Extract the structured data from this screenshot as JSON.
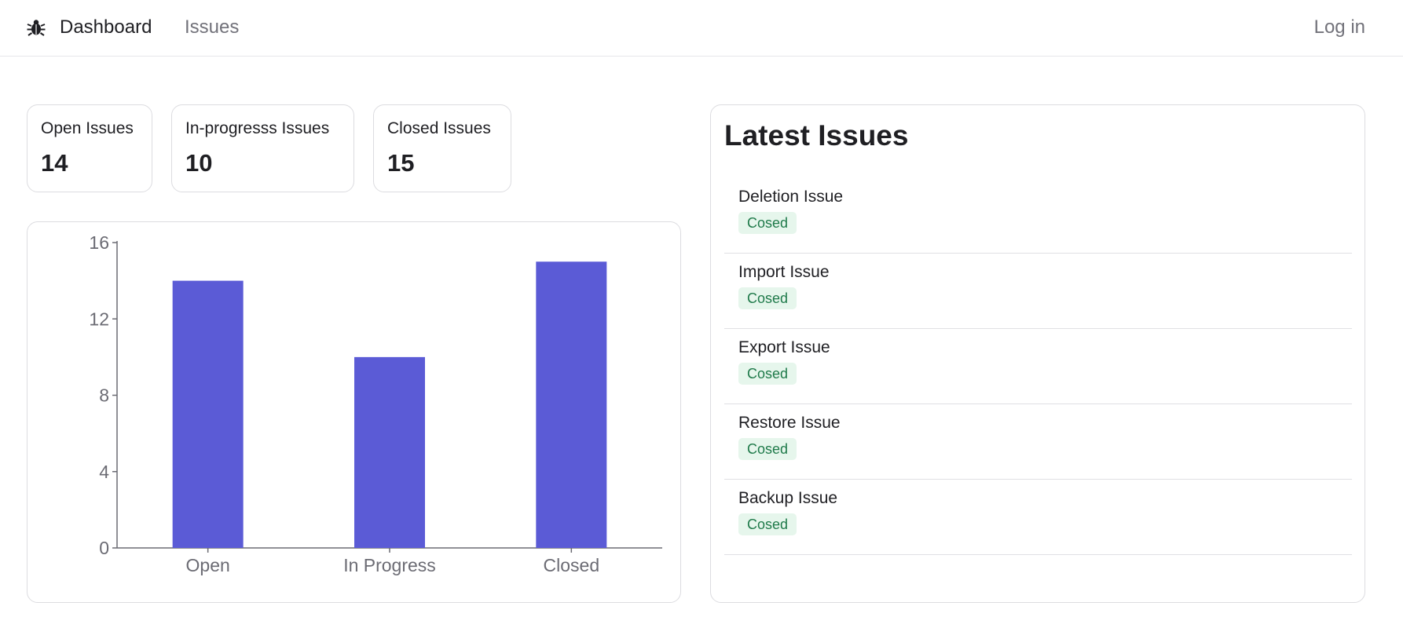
{
  "nav": {
    "logo_icon": "bug-icon",
    "dashboard_label": "Dashboard",
    "issues_label": "Issues",
    "login_label": "Log in"
  },
  "stats": [
    {
      "label": "Open Issues",
      "value": "14"
    },
    {
      "label": "In-progresss Issues",
      "value": "10"
    },
    {
      "label": "Closed Issues",
      "value": "15"
    }
  ],
  "colors": {
    "accent": "#5b5bd6",
    "badge_bg": "#e6f6ec",
    "badge_text": "#1f7a4a"
  },
  "chart_data": {
    "type": "bar",
    "categories": [
      "Open",
      "In Progress",
      "Closed"
    ],
    "values": [
      14,
      10,
      15
    ],
    "ylim": [
      0,
      16
    ],
    "yticks": [
      0,
      4,
      8,
      12,
      16
    ],
    "grid": false
  },
  "latest": {
    "title": "Latest Issues",
    "items": [
      {
        "title": "Deletion Issue",
        "status": "Cosed"
      },
      {
        "title": "Import Issue",
        "status": "Cosed"
      },
      {
        "title": "Export Issue",
        "status": "Cosed"
      },
      {
        "title": "Restore Issue",
        "status": "Cosed"
      },
      {
        "title": "Backup Issue",
        "status": "Cosed"
      }
    ]
  }
}
